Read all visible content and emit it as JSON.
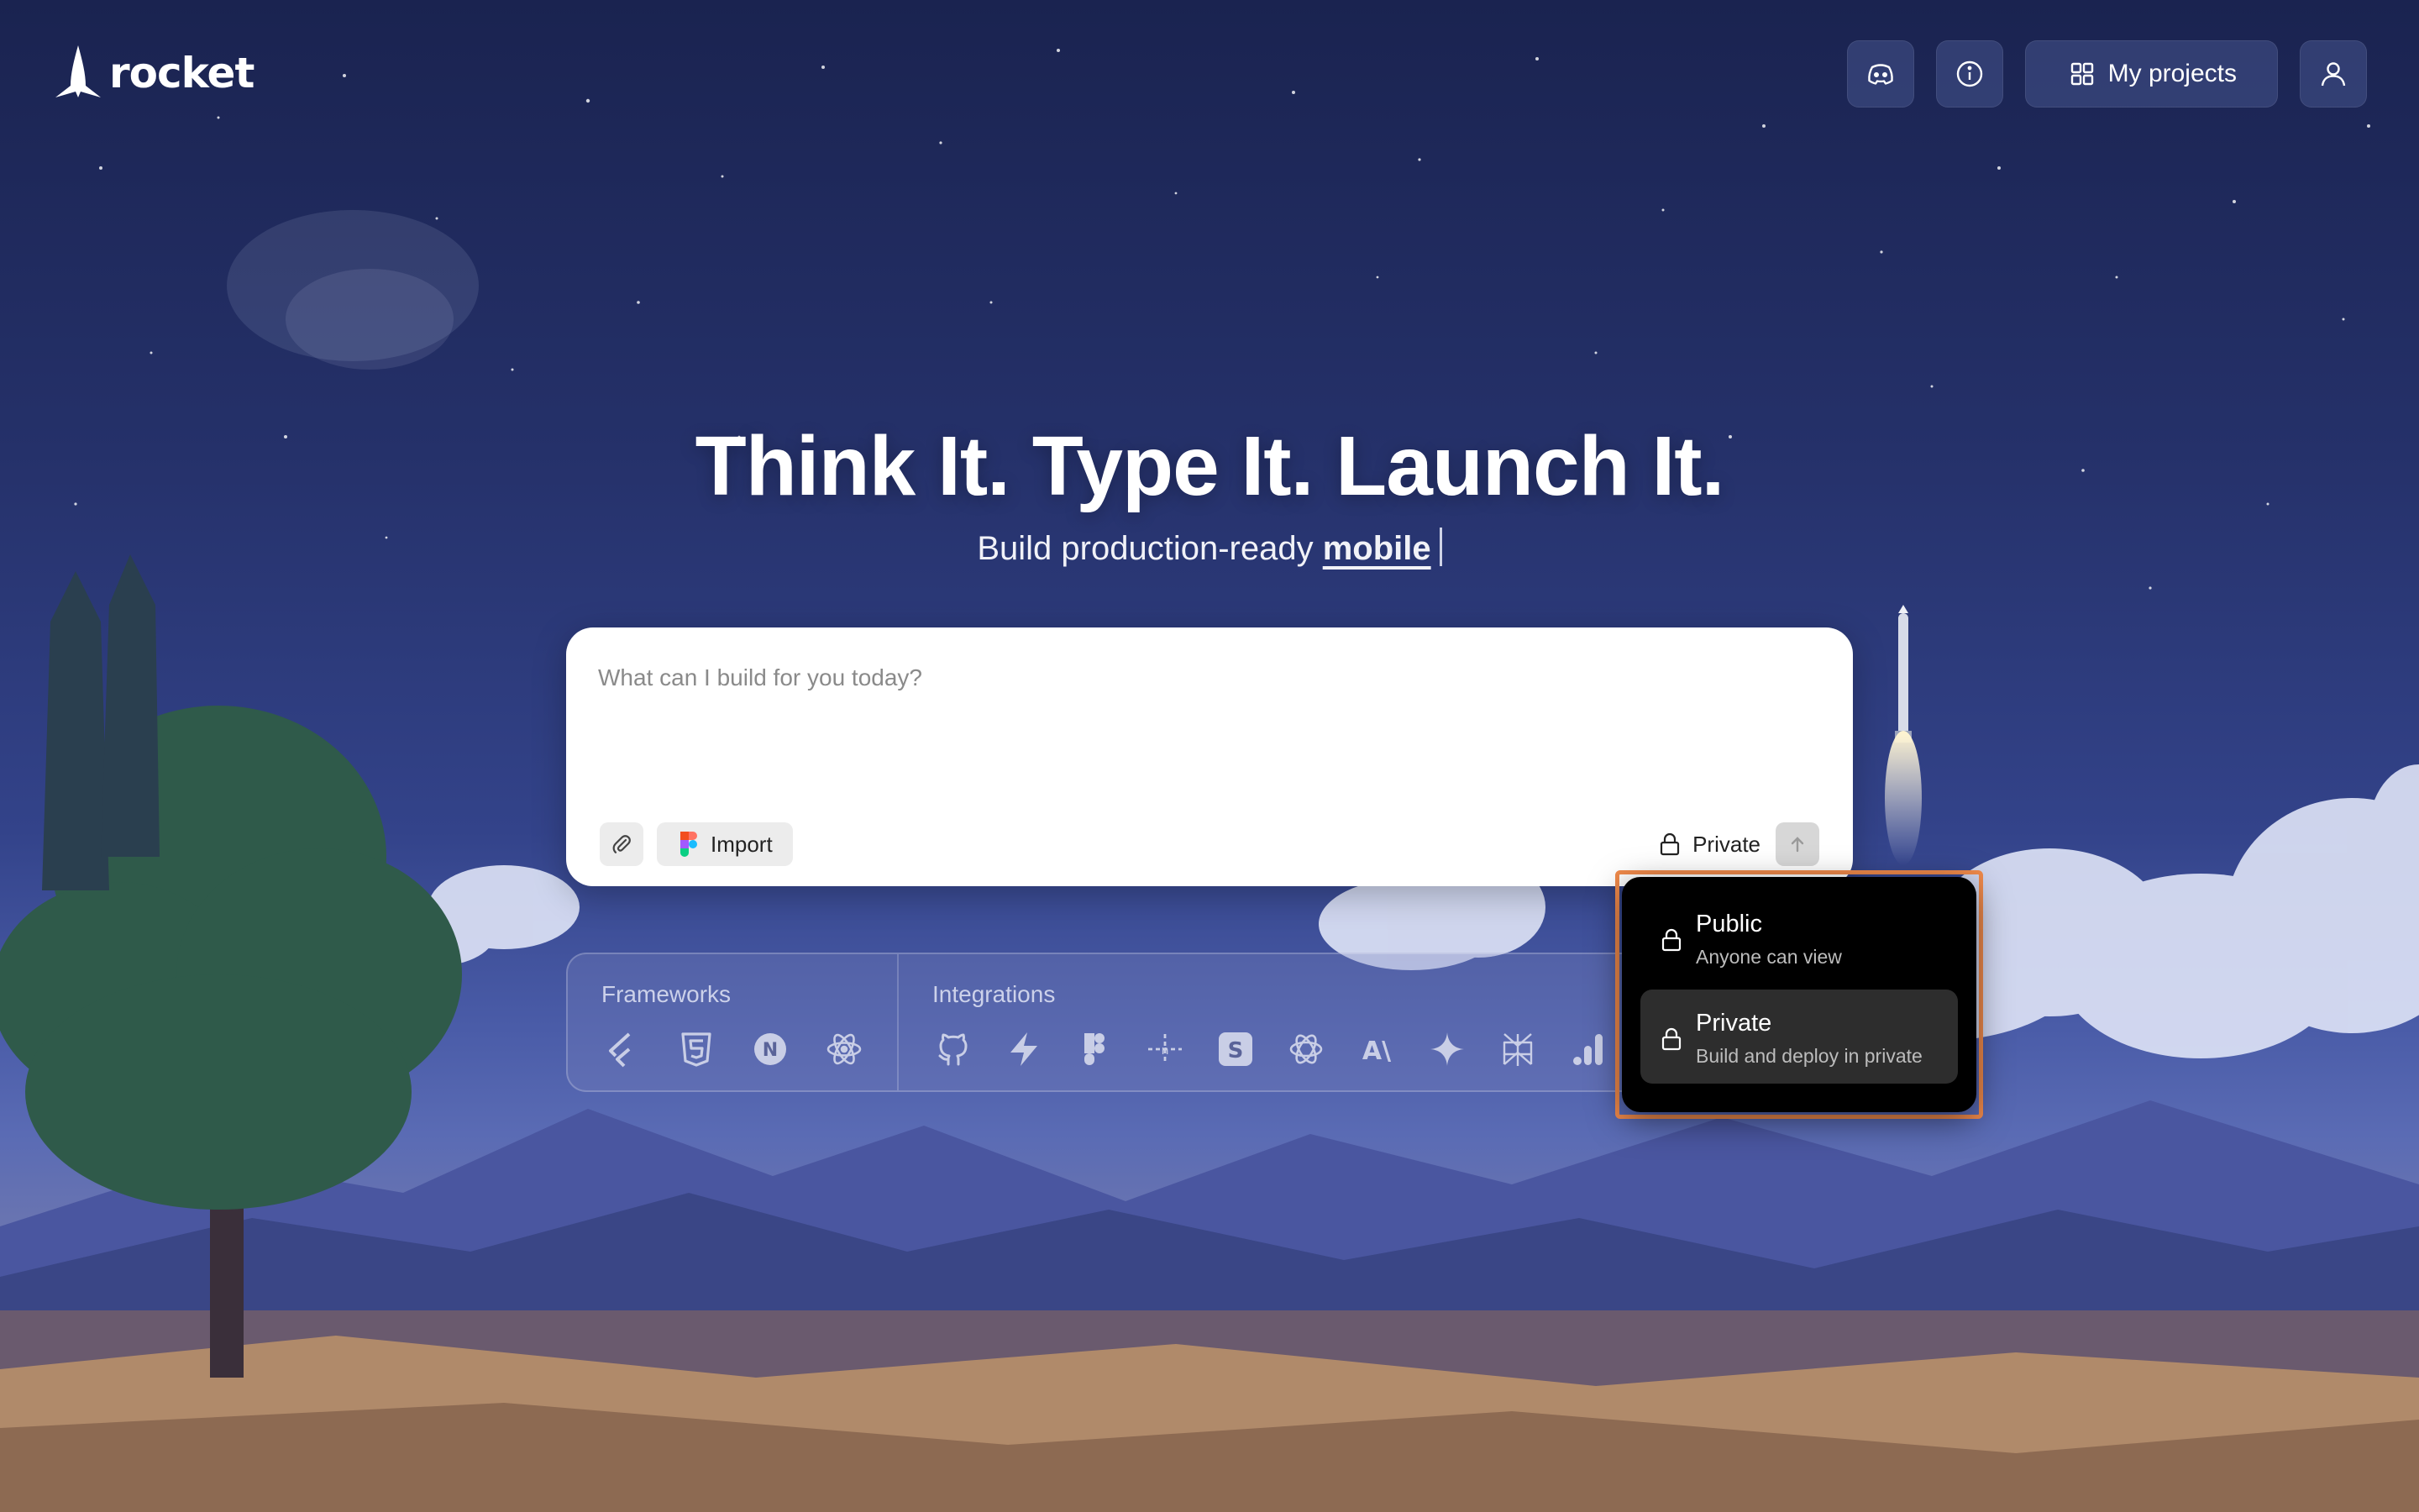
{
  "brand": {
    "name": "rocket"
  },
  "header": {
    "discord_icon": "discord-icon",
    "info_icon": "info-icon",
    "projects_label": "My projects",
    "profile_icon": "user-icon"
  },
  "hero": {
    "title": "Think It. Type It. Launch It.",
    "subtitle_prefix": "Build production-ready",
    "subtitle_highlight": "mobile"
  },
  "prompt": {
    "placeholder": "What can I build for you today?",
    "value": "",
    "import_label": "Import",
    "visibility_label": "Private"
  },
  "strip": {
    "frameworks_label": "Frameworks",
    "frameworks": [
      "flutter-icon",
      "html5-icon",
      "nextjs-icon",
      "react-icon"
    ],
    "integrations_label": "Integrations",
    "integrations": [
      "github-icon",
      "supabase-icon",
      "figma-icon",
      "n8n-icon",
      "stripe-icon",
      "openai-icon",
      "anthropic-icon",
      "gemini-icon",
      "perplexity-icon",
      "analytics-icon"
    ]
  },
  "visibility_menu": {
    "options": [
      {
        "title": "Public",
        "description": "Anyone can view",
        "selected": false
      },
      {
        "title": "Private",
        "description": "Build and deploy in private",
        "selected": true
      }
    ]
  },
  "colors": {
    "accent_highlight": "#f08a4b",
    "dropdown_bg": "#000000",
    "prompt_bg": "#ffffff"
  }
}
